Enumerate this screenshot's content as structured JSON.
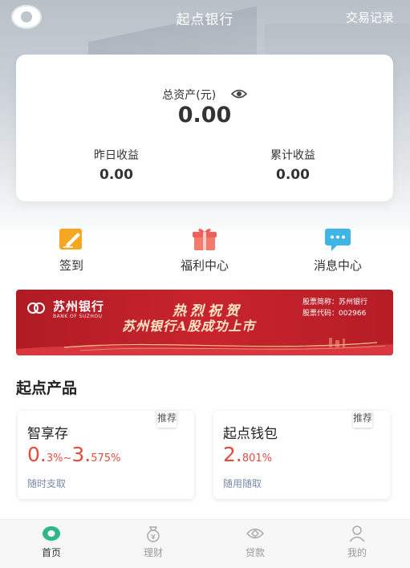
{
  "header": {
    "title": "起点银行",
    "right_link": "交易记录"
  },
  "assets": {
    "total_label": "总资产(元)",
    "total_value": "0.00",
    "yesterday_label": "昨日收益",
    "yesterday_value": "0.00",
    "cumulative_label": "累计收益",
    "cumulative_value": "0.00"
  },
  "quick_actions": [
    {
      "label": "签到",
      "icon": "checkin-pencil-icon",
      "color": "#f5a623"
    },
    {
      "label": "福利中心",
      "icon": "gift-icon",
      "color": "#f0605a"
    },
    {
      "label": "消息中心",
      "icon": "message-bubble-icon",
      "color": "#3fb4e6"
    }
  ],
  "banner": {
    "bank_name": "苏州银行",
    "bank_name_en": "BANK OF SUZHOU",
    "headline_1": "热烈祝贺",
    "headline_2": "苏州银行A股成功上市",
    "stock_name": "股票简称：苏州银行",
    "stock_code": "股票代码：002966"
  },
  "products_section": {
    "title": "起点产品",
    "items": [
      {
        "name": "智享存",
        "rate_min": "0.",
        "rate_min_small": "3%",
        "rate_sep": "~",
        "rate_max": "3.",
        "rate_max_small": "575%",
        "desc": "随时支取",
        "tag": "推荐"
      },
      {
        "name": "起点钱包",
        "rate_main": "2.",
        "rate_small": "801%",
        "desc": "随用随取",
        "tag": "推荐"
      }
    ]
  },
  "tabbar": [
    {
      "label": "首页",
      "icon": "home-icon",
      "active": true
    },
    {
      "label": "理财",
      "icon": "wealth-bag-icon",
      "active": false
    },
    {
      "label": "贷款",
      "icon": "loan-eye-icon",
      "active": false
    },
    {
      "label": "我的",
      "icon": "profile-icon",
      "active": false
    }
  ],
  "colors": {
    "accent": "#e64a3e",
    "active_tab": "#2eb88a",
    "banner_red": "#c9242d"
  }
}
